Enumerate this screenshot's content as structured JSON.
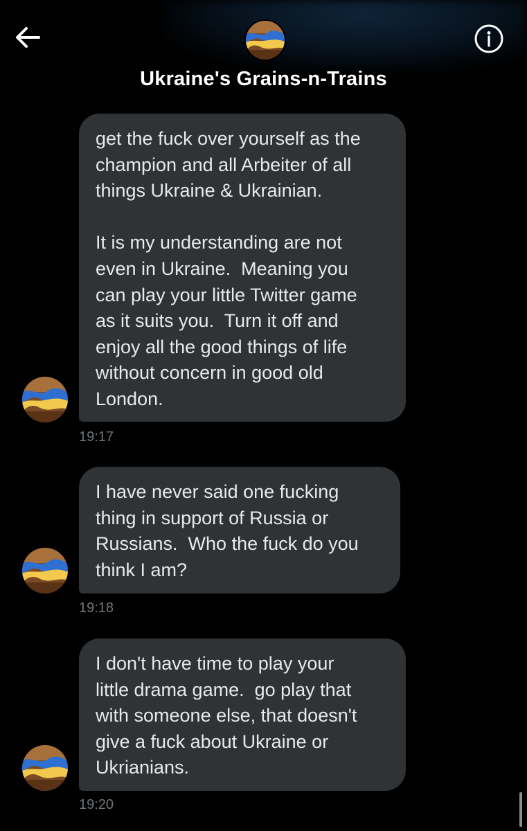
{
  "header": {
    "title": "Ukraine's Grains-n-Trains",
    "back_icon": "arrow-left-icon",
    "info_icon": "info-icon"
  },
  "messages": [
    {
      "text": "get the fuck over yourself as the\nchampion and all Arbeiter of all\nthings Ukraine & Ukrainian.\n\nIt is my understanding are not\neven in Ukraine.  Meaning you\ncan play your little Twitter game\nas it suits you.  Turn it off and\nenjoy all the good things of life\nwithout concern in good old\nLondon.",
      "time": "19:17"
    },
    {
      "text": "I have never said one fucking\nthing in support of Russia or\nRussians.  Who the fuck do you\nthink I am?",
      "time": "19:18"
    },
    {
      "text": "I don't have time to play your\nlittle drama game.  go play that\nwith someone else, that doesn't\ngive a fuck about Ukraine or\nUkrianians.",
      "time": "19:20"
    }
  ],
  "colors": {
    "background": "#000000",
    "bubble": "#2f3336",
    "text": "#e7e9ea",
    "timestamp": "#71767b",
    "flag_blue": "#2f6fd1",
    "flag_yellow": "#f2c94c"
  }
}
